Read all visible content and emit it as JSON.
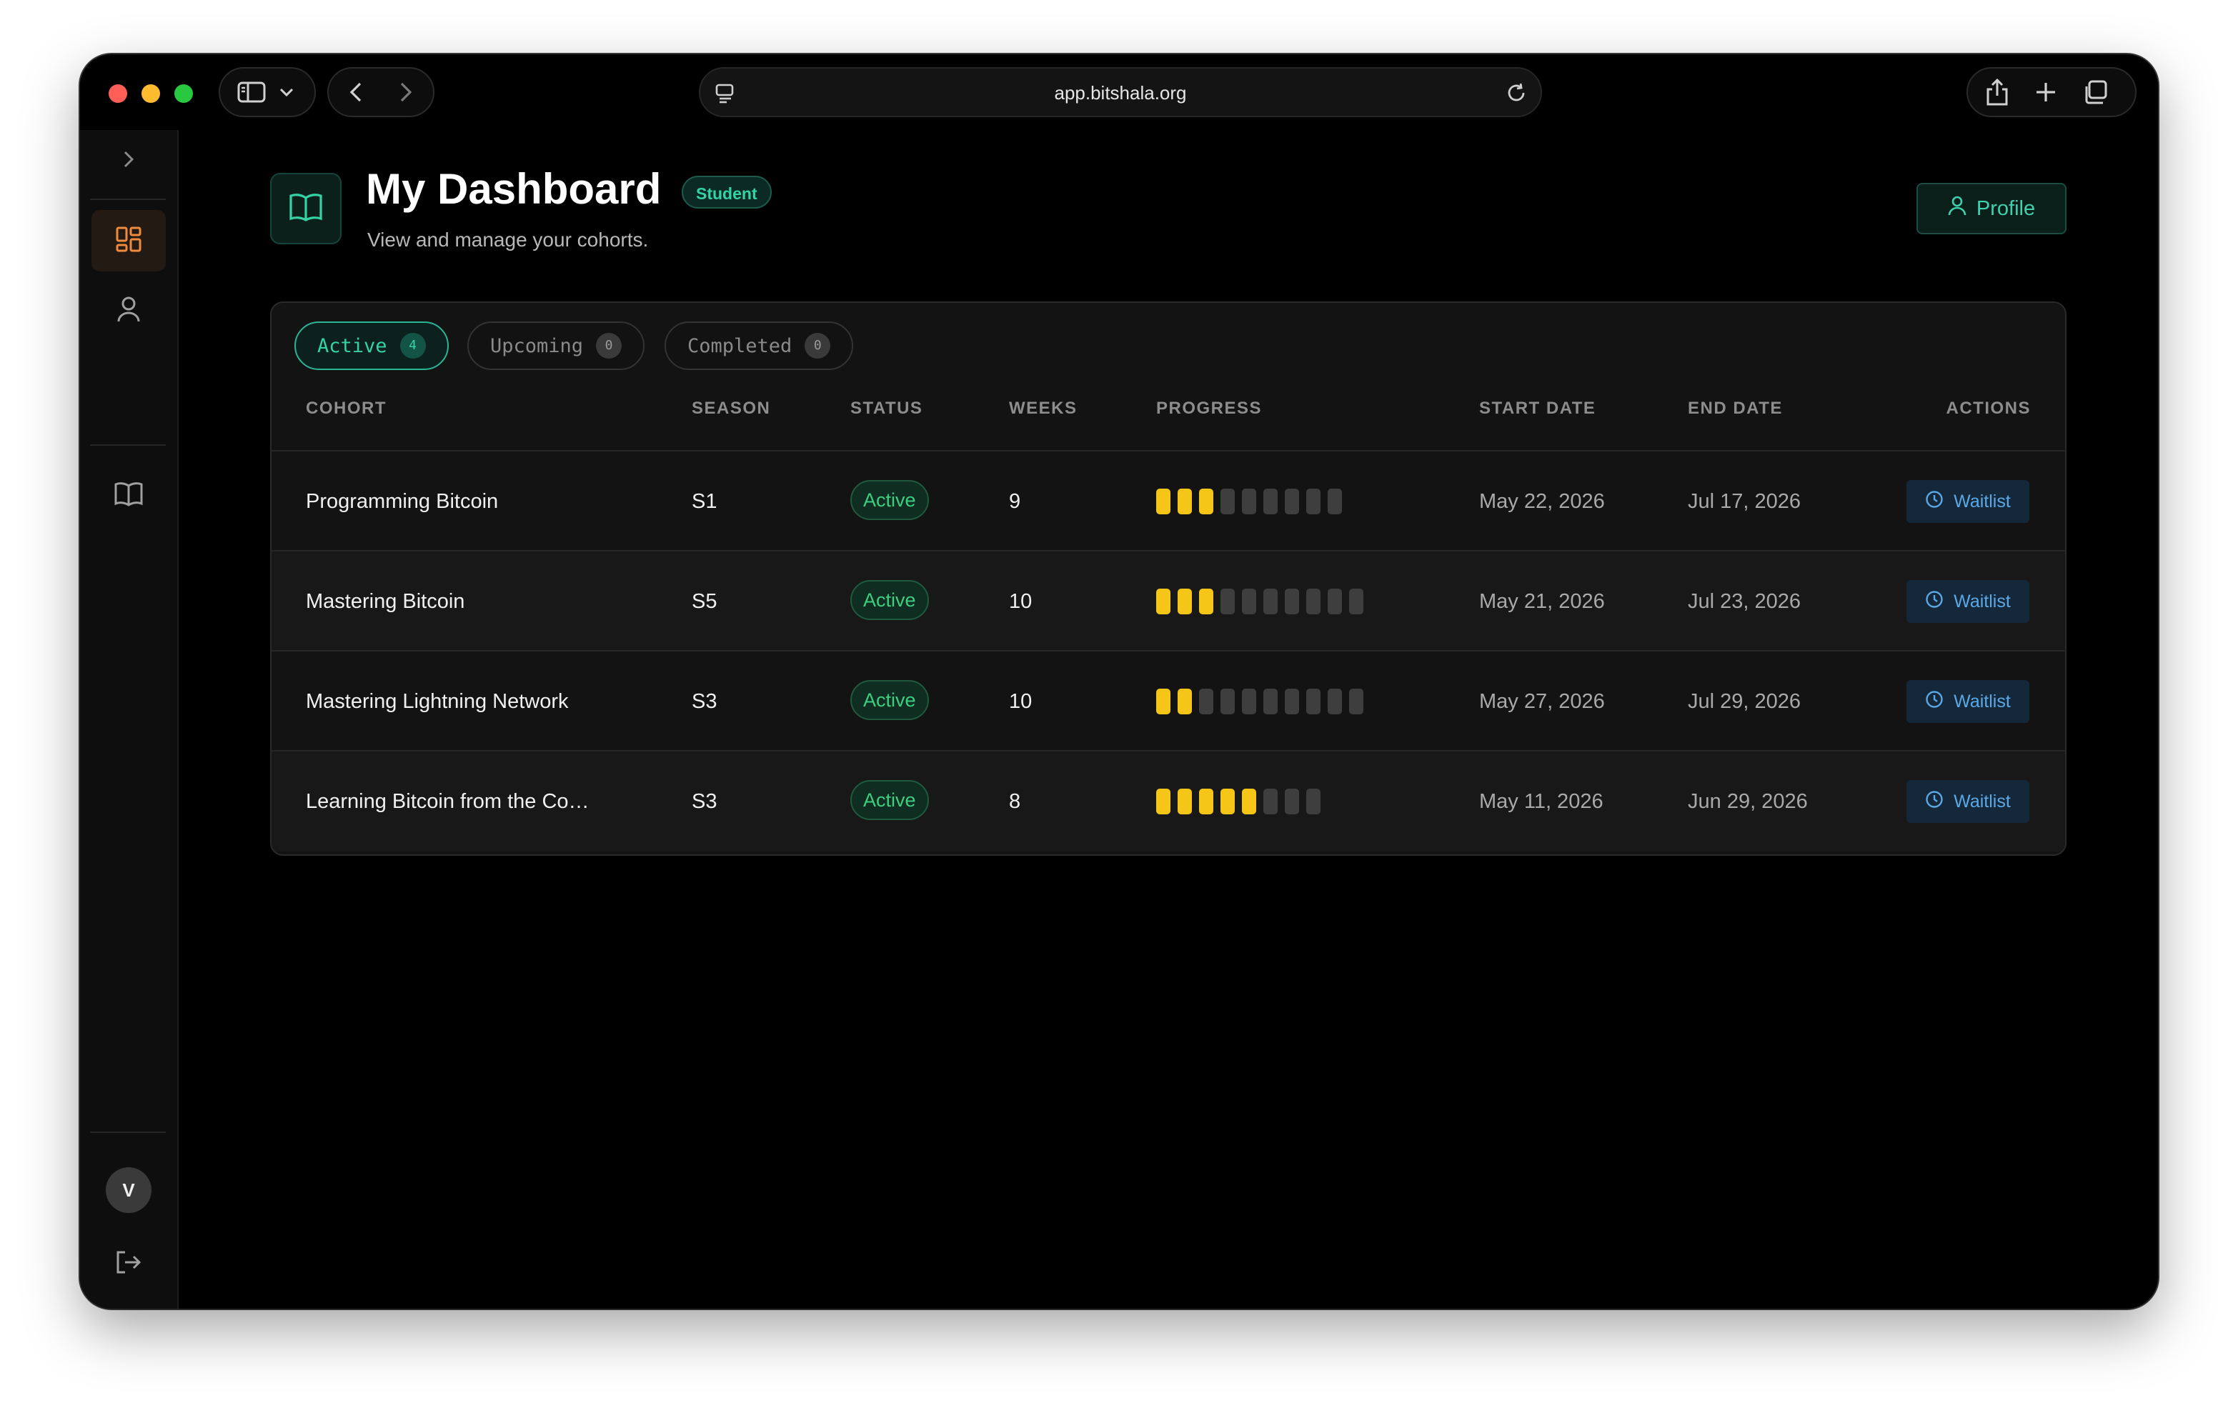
{
  "browser": {
    "url": "app.bitshala.org"
  },
  "sidebar": {
    "avatar_initial": "V"
  },
  "header": {
    "title": "My Dashboard",
    "role_badge": "Student",
    "subtitle": "View and manage your cohorts.",
    "profile_label": "Profile"
  },
  "tabs": [
    {
      "label": "Active",
      "count": "4"
    },
    {
      "label": "Upcoming",
      "count": "0"
    },
    {
      "label": "Completed",
      "count": "0"
    }
  ],
  "table": {
    "columns": [
      "COHORT",
      "SEASON",
      "STATUS",
      "WEEKS",
      "PROGRESS",
      "START DATE",
      "END DATE",
      "ACTIONS"
    ],
    "rows": [
      {
        "cohort": "Programming Bitcoin",
        "season": "S1",
        "status": "Active",
        "weeks": "9",
        "progress_done": 3,
        "progress_total": 9,
        "start": "May 22, 2026",
        "end": "Jul 17, 2026",
        "action": "Waitlist"
      },
      {
        "cohort": "Mastering Bitcoin",
        "season": "S5",
        "status": "Active",
        "weeks": "10",
        "progress_done": 3,
        "progress_total": 10,
        "start": "May 21, 2026",
        "end": "Jul 23, 2026",
        "action": "Waitlist"
      },
      {
        "cohort": "Mastering Lightning Network",
        "season": "S3",
        "status": "Active",
        "weeks": "10",
        "progress_done": 2,
        "progress_total": 10,
        "start": "May 27, 2026",
        "end": "Jul 29, 2026",
        "action": "Waitlist"
      },
      {
        "cohort": "Learning Bitcoin from the Co…",
        "season": "S3",
        "status": "Active",
        "weeks": "8",
        "progress_done": 5,
        "progress_total": 8,
        "start": "May 11, 2026",
        "end": "Jun 29, 2026",
        "action": "Waitlist"
      }
    ]
  },
  "colors": {
    "accent": "#34d3a6",
    "progress_on": "#f5c518",
    "progress_off": "#3e3e3e",
    "active_nav": "#f08a3c"
  }
}
